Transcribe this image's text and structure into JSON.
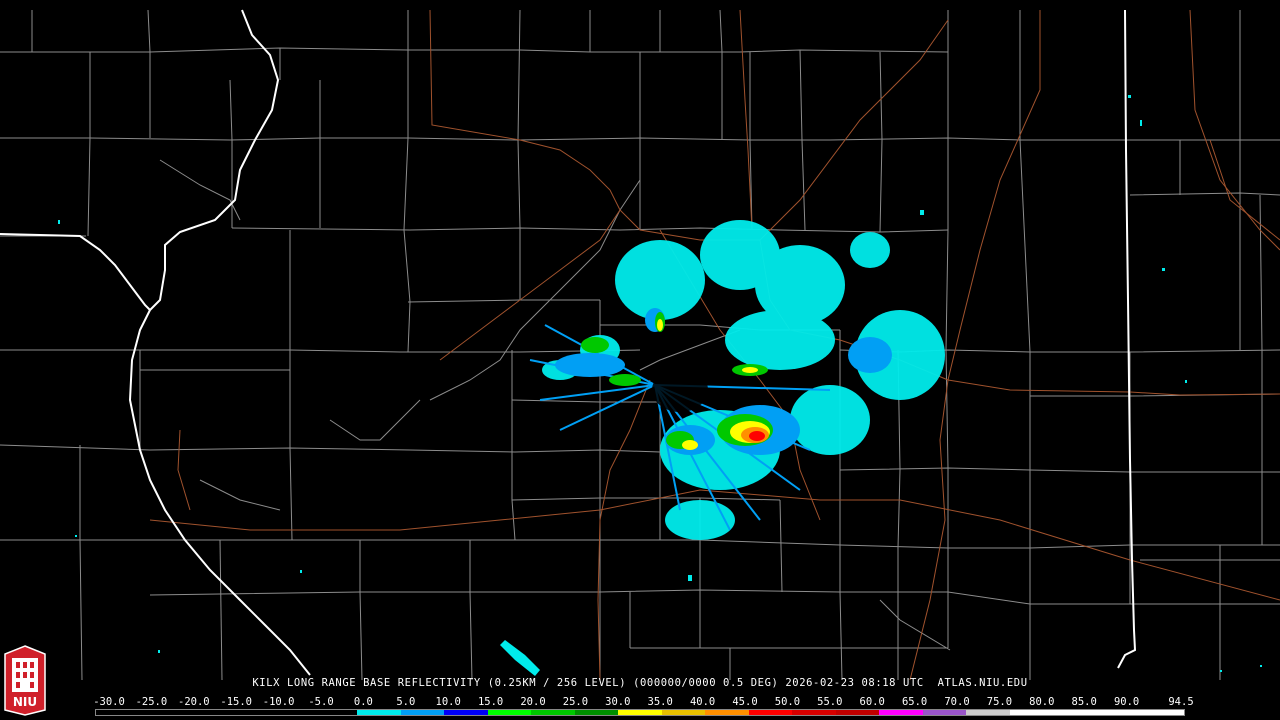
{
  "product": {
    "site": "KILX",
    "description": "LONG RANGE BASE REFLECTIVITY",
    "resolution": "(0.25KM / 256 LEVEL)",
    "volume": "(000000/0000 0.5 DEG)",
    "date": "2026-02-23",
    "time": "08:18 UTC",
    "website": "ATLAS.NIU.EDU"
  },
  "legend": {
    "scale_labels": [
      "-30.0",
      "-25.0",
      "-20.0",
      "-15.0",
      "-10.0",
      "-5.0",
      "0.0",
      "5.0",
      "10.0",
      "15.0",
      "20.0",
      "25.0",
      "30.0",
      "35.0",
      "40.0",
      "45.0",
      "50.0",
      "55.0",
      "60.0",
      "65.0",
      "70.0",
      "75.0",
      "80.0",
      "85.0",
      "90.0",
      "94.5"
    ],
    "scale_colors": [
      "#000000",
      "#000000",
      "#000000",
      "#000000",
      "#000000",
      "#000000",
      "#00ecec",
      "#019ff4",
      "#0000f6",
      "#00ff00",
      "#00c800",
      "#009000",
      "#ffff00",
      "#e7c000",
      "#ff9000",
      "#ff0000",
      "#d60000",
      "#c00000",
      "#ff00ff",
      "#9955c9",
      "#cccccc",
      "#ffffff",
      "#ffffff",
      "#ffffff",
      "#ffffff"
    ]
  },
  "logo": {
    "text": "NIU",
    "color": "#d0202a"
  },
  "map_colors": {
    "background": "#000000",
    "state_border": "#ffffff",
    "county_border": "#8c8c8c",
    "highway": "#a0522d"
  }
}
